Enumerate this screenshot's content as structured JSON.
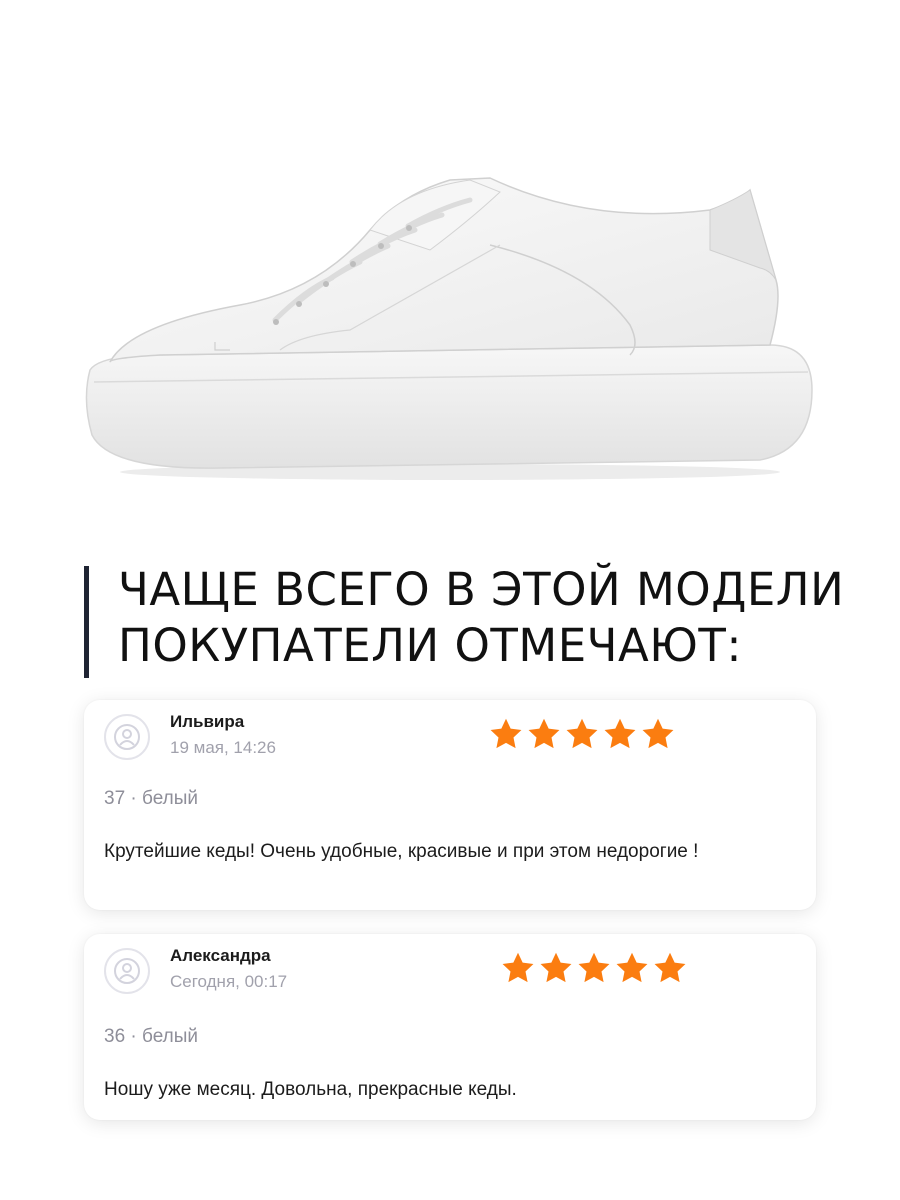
{
  "product": {
    "image_alt": "white-sneaker",
    "color": "#ffffff"
  },
  "heading": {
    "line1": "ЧАЩЕ ВСЕГО В ЭТОЙ МОДЕЛИ",
    "line2": "ПОКУПАТЕЛИ ОТМЕЧАЮТ:"
  },
  "reviews": [
    {
      "author": "Ильвира",
      "date": "19 мая, 14:26",
      "rating": 5,
      "meta": "37 · белый",
      "text": "Крутейшие кеды! Очень удобные, красивые  и при этом недорогие !"
    },
    {
      "author": "Александра",
      "date": "Сегодня, 00:17",
      "rating": 5,
      "meta": "36 · белый",
      "text": "Ношу уже месяц. Довольна, прекрасные кеды."
    }
  ],
  "colors": {
    "star": "#fb7d10",
    "accent_bar": "#1f2433",
    "muted": "#a1a1ac"
  },
  "icons": {
    "avatar": "user-icon",
    "rating": "star-icon"
  }
}
